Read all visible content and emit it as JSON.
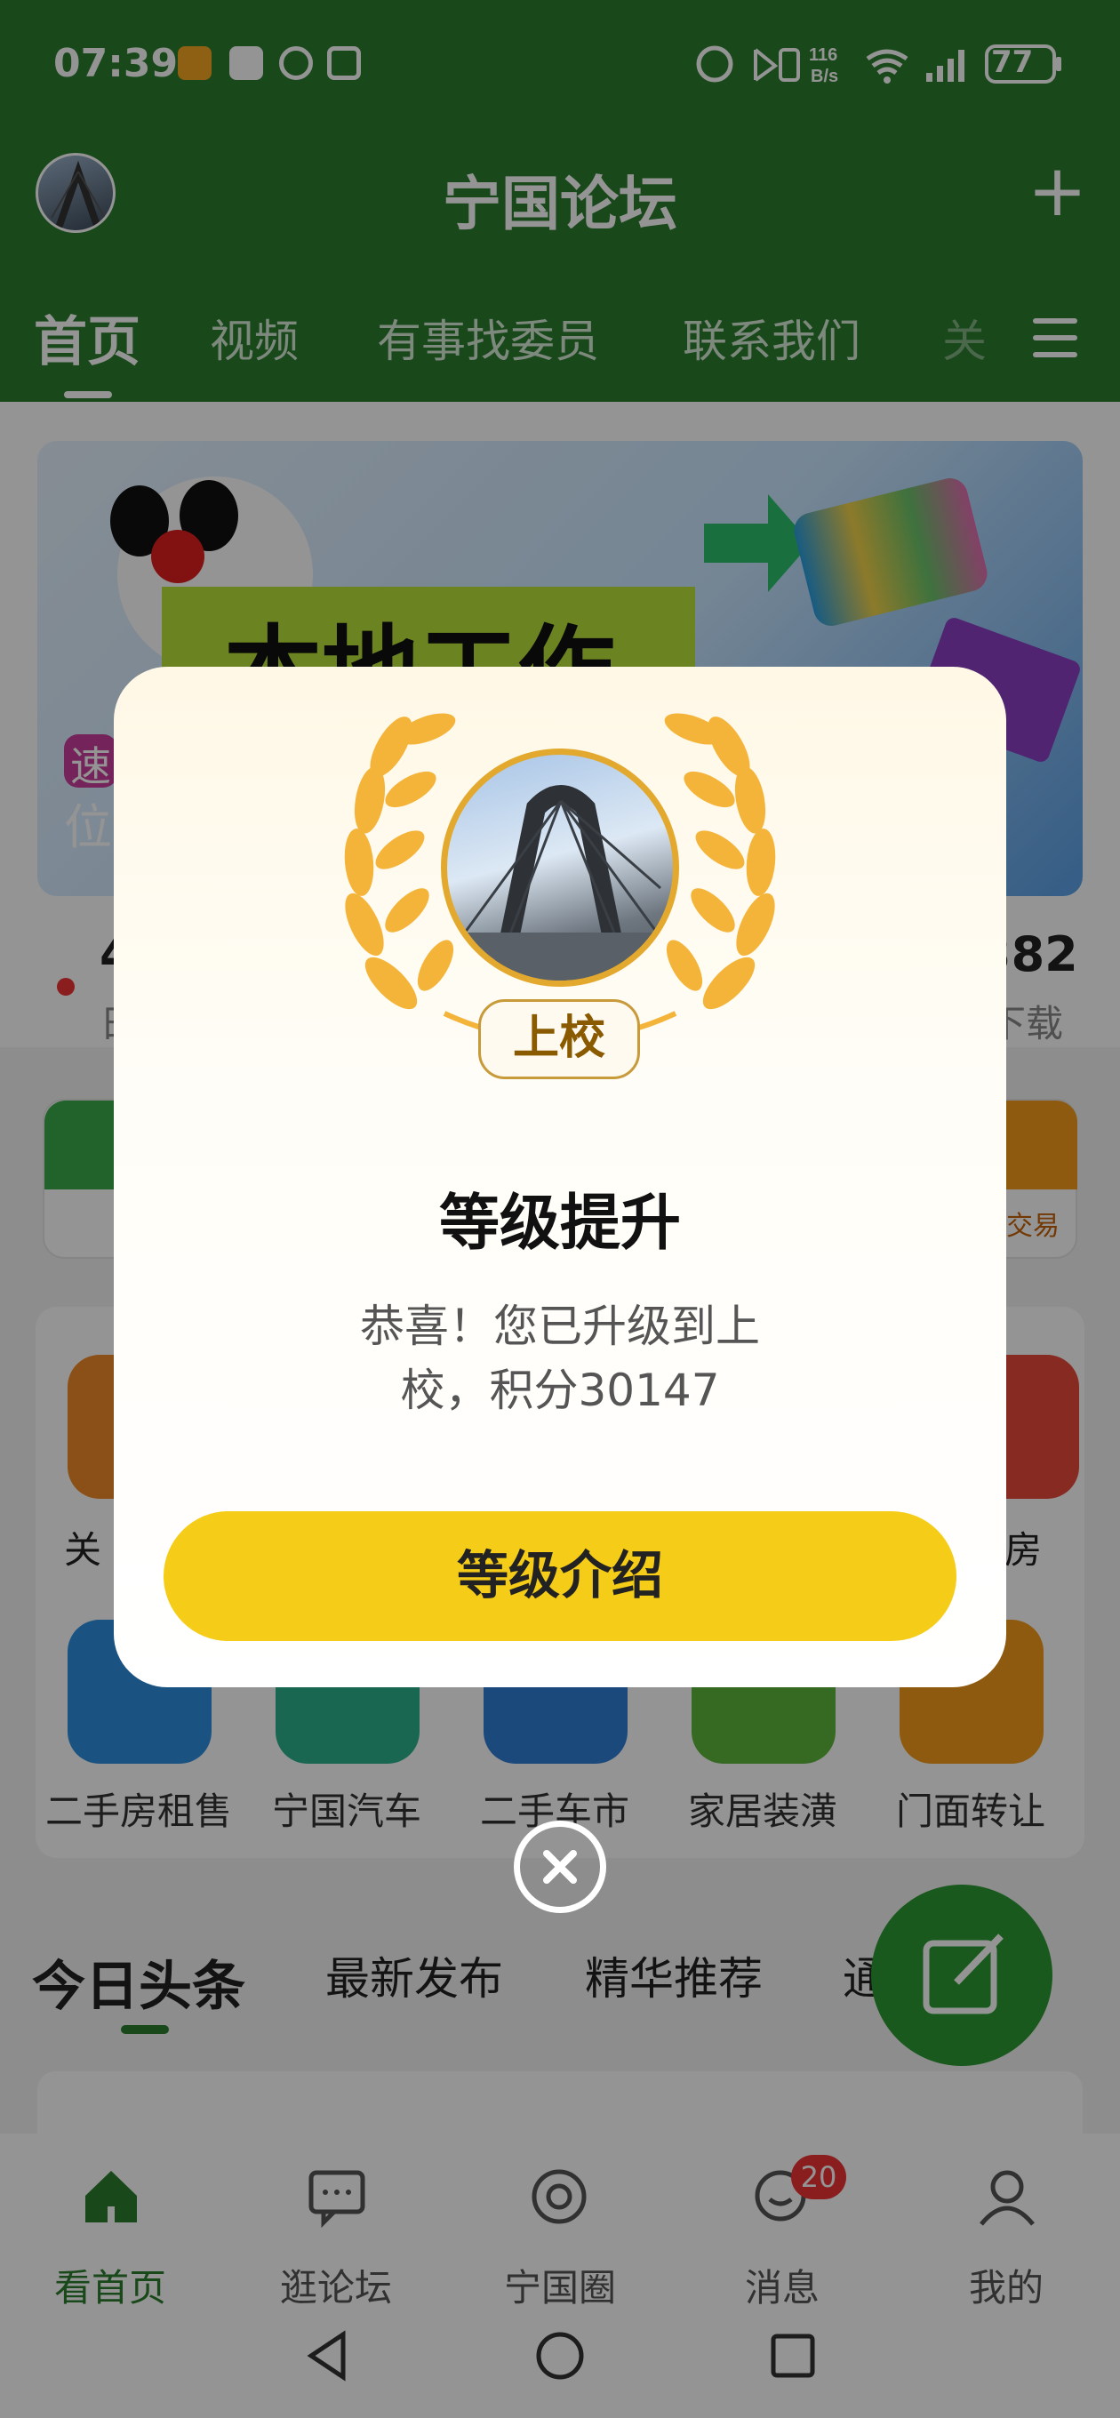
{
  "status_bar": {
    "time": "07:39",
    "speed": "116\nB/s",
    "battery": "77"
  },
  "header": {
    "title": "宁国论坛",
    "add_icon": "plus-icon"
  },
  "nav_tabs": [
    "首页",
    "视频",
    "有事找委员",
    "联系我们",
    "关"
  ],
  "banner": {
    "text": "本地工作",
    "badge": "速",
    "sub": "位"
  },
  "stats": {
    "left_num": "4",
    "left_label": "日",
    "right_num": "382",
    "right_label": "下载"
  },
  "cards": {
    "right_label": "交易"
  },
  "grid_row1": [
    "关",
    "房"
  ],
  "grid_row2": [
    "二手房租售",
    "宁国汽车",
    "二手车市",
    "家居装潢",
    "门面转让"
  ],
  "feed_tabs": [
    "今日头条",
    "最新发布",
    "精华推荐",
    "通"
  ],
  "bottom_nav": [
    {
      "label": "看首页",
      "icon": "home-icon"
    },
    {
      "label": "逛论坛",
      "icon": "chat-icon"
    },
    {
      "label": "宁国圈",
      "icon": "circle-icon"
    },
    {
      "label": "消息",
      "icon": "message-icon",
      "badge": "20"
    },
    {
      "label": "我的",
      "icon": "user-icon"
    }
  ],
  "modal": {
    "rank": "上校",
    "title": "等级提升",
    "message_line1": "恭喜！您已升级到上",
    "message_line2": "校，积分30147",
    "button": "等级介绍"
  },
  "colors": {
    "brand_green": "#2b7d2e",
    "button_yellow": "#f5cd19",
    "laurel_gold": "#f4b43a"
  }
}
